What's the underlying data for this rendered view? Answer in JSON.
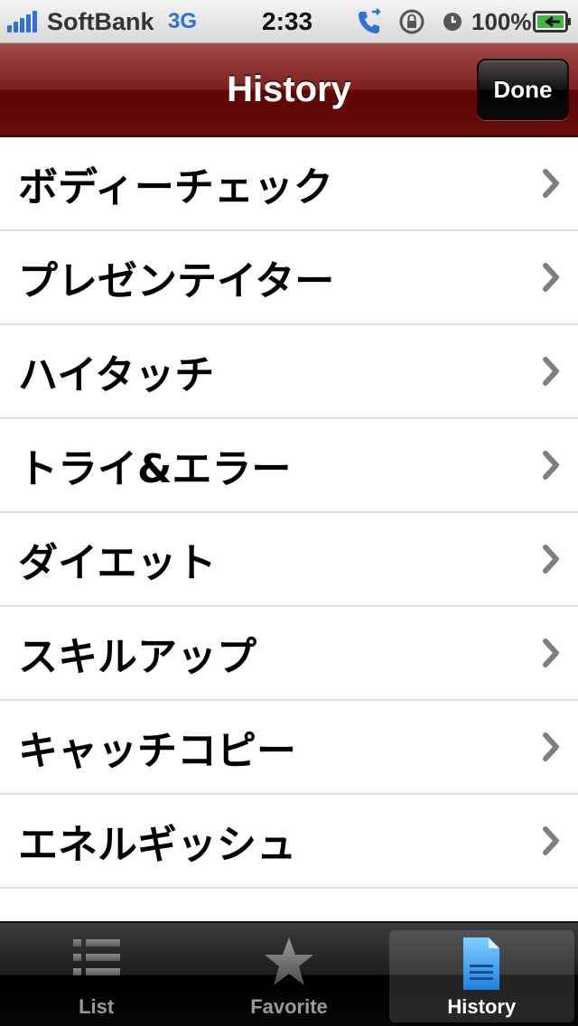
{
  "status_bar": {
    "carrier": "SoftBank",
    "network": "3G",
    "time": "2:33",
    "battery_percent": "100%",
    "icons": [
      "signal-icon",
      "phone-forward-icon",
      "rotation-lock-icon",
      "alarm-clock-icon",
      "battery-charging-icon"
    ]
  },
  "nav": {
    "title": "History",
    "done_label": "Done"
  },
  "list": {
    "items": [
      {
        "label": "ボディーチェック"
      },
      {
        "label": "プレゼンテイター"
      },
      {
        "label": "ハイタッチ"
      },
      {
        "label": "トライ&エラー"
      },
      {
        "label": "ダイエット"
      },
      {
        "label": "スキルアップ"
      },
      {
        "label": "キャッチコピー"
      },
      {
        "label": "エネルギッシュ"
      }
    ]
  },
  "tabs": [
    {
      "label": "List",
      "icon": "list-icon",
      "selected": false
    },
    {
      "label": "Favorite",
      "icon": "star-icon",
      "selected": false
    },
    {
      "label": "History",
      "icon": "document-icon",
      "selected": true
    }
  ],
  "colors": {
    "nav_bar": "#6b1010",
    "network_blue": "#2d73d6",
    "tab_bar": "#111111",
    "chevron": "#7f7f7f"
  }
}
